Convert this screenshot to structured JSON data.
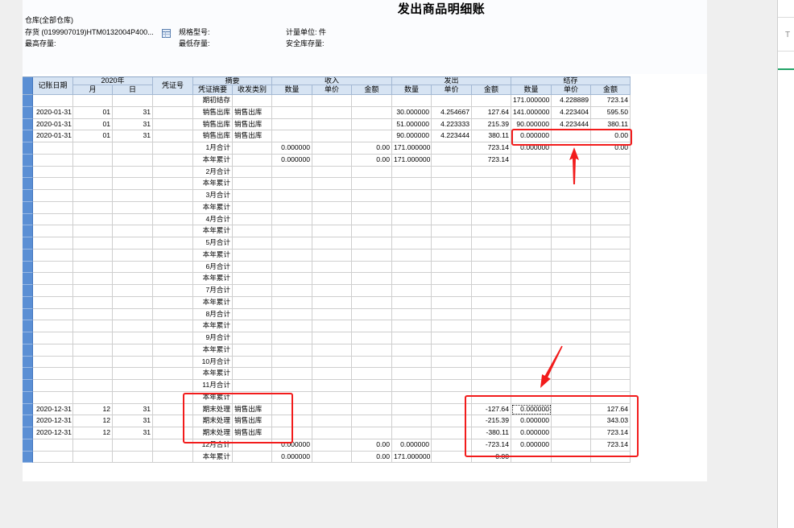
{
  "report": {
    "title": "发出商品明细账",
    "warehouse": "仓库(全部仓库)",
    "inventory": "存货 (0199907019)HTM0132004P400...",
    "spec": "规格型号:",
    "unit": "计量单位: 件",
    "max_stock": "最高存量:",
    "min_stock": "最低存量:",
    "safety_stock": "安全库存量:"
  },
  "icons": {
    "inventory_lookup": "table-lookup-icon"
  },
  "table": {
    "header": {
      "date": "记账日期",
      "year": "2020年",
      "month": "月",
      "day": "日",
      "voucher_no": "凭证号",
      "summary_group": "摘要",
      "voucher_summary": "凭证摘要",
      "category": "收发类别",
      "receipt_group": "收入",
      "issue_group": "发出",
      "balance_group": "结存",
      "qty": "数量",
      "price": "单价",
      "amount": "金额"
    },
    "rows": [
      {
        "summary": "期初结存",
        "bal_qty": "171.000000",
        "bal_price": "4.228889",
        "bal_amount": "723.14"
      },
      {
        "date": "2020-01-31",
        "month": "01",
        "day": "31",
        "summary": "销售出库",
        "category": "销售出库",
        "out_qty": "30.000000",
        "out_price": "4.254667",
        "out_amount": "127.64",
        "bal_qty": "141.000000",
        "bal_price": "4.223404",
        "bal_amount": "595.50"
      },
      {
        "date": "2020-01-31",
        "month": "01",
        "day": "31",
        "summary": "销售出库",
        "category": "销售出库",
        "out_qty": "51.000000",
        "out_price": "4.223333",
        "out_amount": "215.39",
        "bal_qty": "90.000000",
        "bal_price": "4.223444",
        "bal_amount": "380.11"
      },
      {
        "date": "2020-01-31",
        "month": "01",
        "day": "31",
        "summary": "销售出库",
        "category": "销售出库",
        "out_qty": "90.000000",
        "out_price": "4.223444",
        "out_amount": "380.11",
        "bal_qty": "0.000000",
        "bal_amount": "0.00"
      },
      {
        "summary": "1月合计",
        "in_qty": "0.000000",
        "in_amount": "0.00",
        "out_qty": "171.000000",
        "out_amount": "723.14",
        "bal_qty": "0.000000",
        "bal_amount": "0.00"
      },
      {
        "summary": "本年累计",
        "in_qty": "0.000000",
        "in_amount": "0.00",
        "out_qty": "171.000000",
        "out_amount": "723.14"
      },
      {
        "summary": "2月合计"
      },
      {
        "summary": "本年累计"
      },
      {
        "summary": "3月合计"
      },
      {
        "summary": "本年累计"
      },
      {
        "summary": "4月合计"
      },
      {
        "summary": "本年累计"
      },
      {
        "summary": "5月合计"
      },
      {
        "summary": "本年累计"
      },
      {
        "summary": "6月合计"
      },
      {
        "summary": "本年累计"
      },
      {
        "summary": "7月合计"
      },
      {
        "summary": "本年累计"
      },
      {
        "summary": "8月合计"
      },
      {
        "summary": "本年累计"
      },
      {
        "summary": "9月合计"
      },
      {
        "summary": "本年累计"
      },
      {
        "summary": "10月合计"
      },
      {
        "summary": "本年累计"
      },
      {
        "summary": "11月合计"
      },
      {
        "summary": "本年累计"
      },
      {
        "date": "2020-12-31",
        "month": "12",
        "day": "31",
        "summary": "期末处理",
        "category": "销售出库",
        "out_amount": "-127.64",
        "bal_qty": "0.000000",
        "bal_amount": "127.64"
      },
      {
        "date": "2020-12-31",
        "month": "12",
        "day": "31",
        "summary": "期末处理",
        "category": "销售出库",
        "out_amount": "-215.39",
        "bal_qty": "0.000000",
        "bal_amount": "343.03"
      },
      {
        "date": "2020-12-31",
        "month": "12",
        "day": "31",
        "summary": "期末处理",
        "category": "销售出库",
        "out_amount": "-380.11",
        "bal_qty": "0.000000",
        "bal_amount": "723.14"
      },
      {
        "summary": "12月合计",
        "in_qty": "0.000000",
        "in_amount": "0.00",
        "out_qty": "0.000000",
        "out_amount": "-723.14",
        "bal_qty": "0.000000",
        "bal_amount": "723.14"
      },
      {
        "summary": "本年累计",
        "in_qty": "0.000000",
        "in_amount": "0.00",
        "out_qty": "171.000000",
        "out_amount": "0.00"
      }
    ]
  },
  "side_panel": {
    "cell_text": "T"
  },
  "colors": {
    "annotation_red": "#f21c1c",
    "header_bg": "#d7e4f3",
    "row_selector_blue": "#5b8fd4",
    "side_panel_green": "#21a366"
  }
}
